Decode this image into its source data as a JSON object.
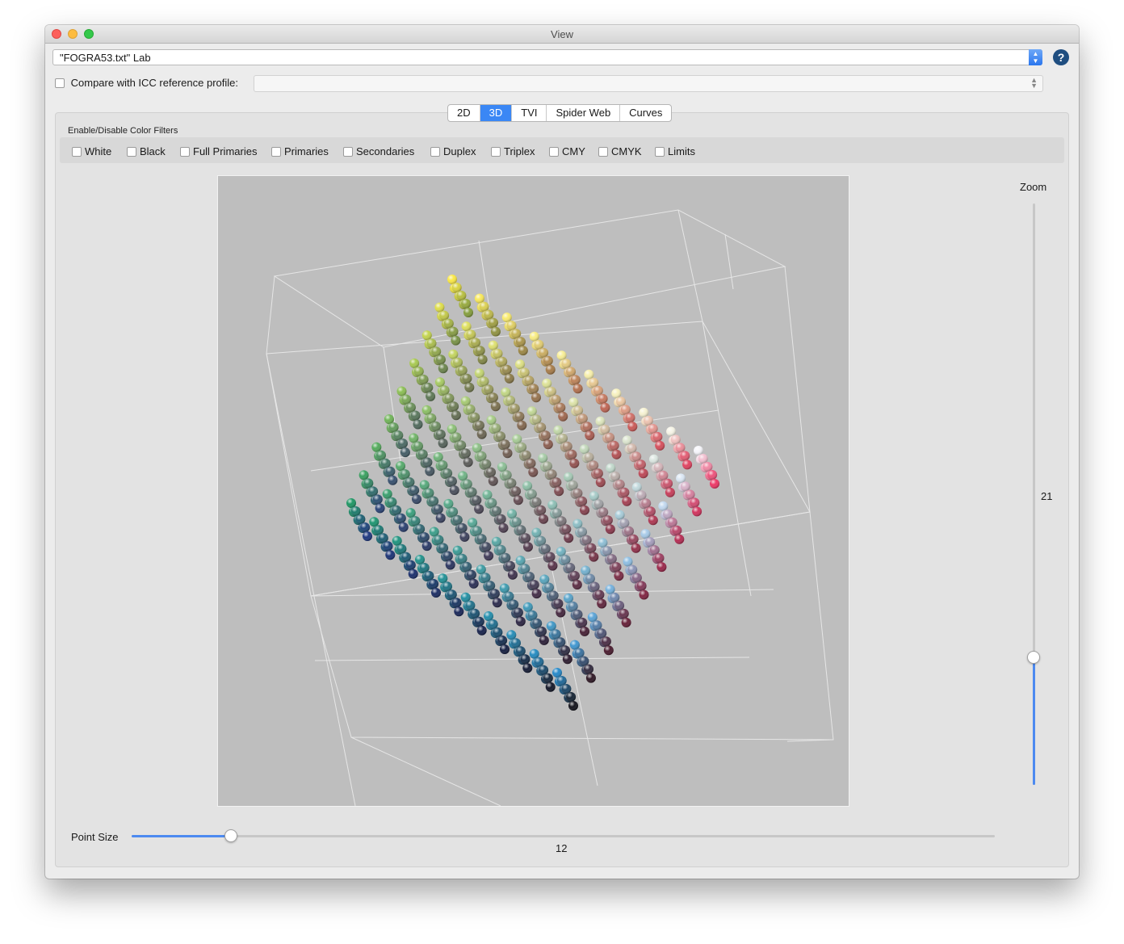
{
  "window": {
    "title": "View"
  },
  "file": {
    "selected": "\"FOGRA53.txt\" Lab"
  },
  "compare": {
    "label": "Compare with ICC reference profile:",
    "checked": false,
    "value": ""
  },
  "tabs": [
    {
      "label": "2D",
      "active": false
    },
    {
      "label": "3D",
      "active": true
    },
    {
      "label": "TVI",
      "active": false
    },
    {
      "label": "Spider Web",
      "active": false
    },
    {
      "label": "Curves",
      "active": false
    }
  ],
  "filters": {
    "title": "Enable/Disable Color Filters",
    "items": [
      {
        "label": "White",
        "checked": false
      },
      {
        "label": "Black",
        "checked": false
      },
      {
        "label": "Full Primaries",
        "checked": false
      },
      {
        "label": "Primaries",
        "checked": false
      },
      {
        "label": "Secondaries",
        "checked": false
      },
      {
        "label": "Duplex",
        "checked": false
      },
      {
        "label": "Triplex",
        "checked": false
      },
      {
        "label": "CMY",
        "checked": false
      },
      {
        "label": "CMYK",
        "checked": false
      },
      {
        "label": "Limits",
        "checked": false
      }
    ]
  },
  "zoom": {
    "label": "Zoom",
    "value": "21",
    "fraction": 0.22
  },
  "point_size": {
    "label": "Point Size",
    "value": "12",
    "fraction": 0.115
  },
  "colors": {
    "accent": "#3a87f5",
    "slider_fill": "#4d8af0",
    "plot_bg": "#bebebe"
  },
  "icons": {
    "help": "question-icon",
    "select_arrow": "updown-chevron-icon"
  },
  "help_glyph": "?"
}
